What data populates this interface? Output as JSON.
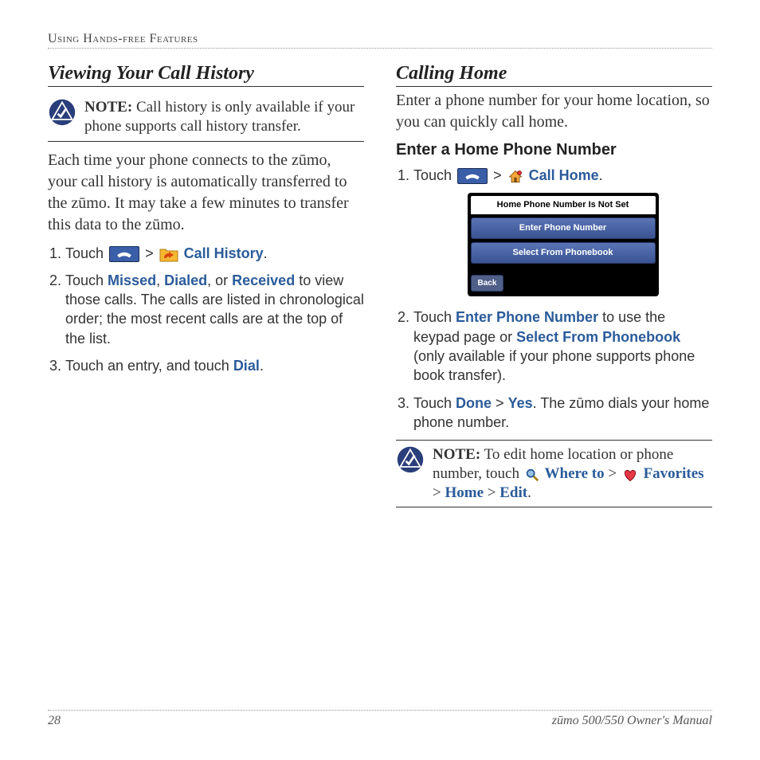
{
  "header": {
    "section": "Using Hands-free Features"
  },
  "left": {
    "heading": "Viewing Your Call History",
    "note": {
      "label": "NOTE:",
      "text": "Call history is only available if your phone supports call history transfer."
    },
    "paragraph": "Each time your phone connects to the zūmo, your call history is automatically transferred to the zūmo. It may take a few minutes to transfer this data to the zūmo.",
    "steps": {
      "s1_pre": "Touch ",
      "s1_sep": " > ",
      "s1_link": "Call History",
      "s1_post": ".",
      "s2_pre": "Touch ",
      "s2_missed": "Missed",
      "s2_c1": ", ",
      "s2_dialed": "Dialed",
      "s2_c2": ", or ",
      "s2_received": "Received",
      "s2_rest": " to view those calls. The calls are listed in chronological order; the most recent calls are at the top of the list.",
      "s3_pre": "Touch an entry, and touch ",
      "s3_dial": "Dial",
      "s3_post": "."
    }
  },
  "right": {
    "heading": "Calling Home",
    "paragraph": "Enter a phone number for your home location, so you can quickly call home.",
    "subheading": "Enter a Home Phone Number",
    "step1_pre": "Touch ",
    "step1_sep": " > ",
    "step1_link": "Call Home",
    "step1_post": ".",
    "device": {
      "title": "Home Phone Number Is Not Set",
      "btn1": "Enter Phone Number",
      "btn2": "Select From Phonebook",
      "back": "Back"
    },
    "step2_pre": "Touch ",
    "step2_link1": "Enter Phone Number",
    "step2_mid": " to use the keypad page or ",
    "step2_link2": "Select From Phonebook",
    "step2_rest": " (only available if your phone supports phone book transfer).",
    "step3_pre": "Touch ",
    "step3_done": "Done",
    "step3_sep": " > ",
    "step3_yes": "Yes",
    "step3_rest": ". The zūmo dials your home phone number.",
    "note2": {
      "label": "NOTE:",
      "pre": "To edit home location or phone number, touch ",
      "where": "Where to",
      "sep1": " > ",
      "fav": "Favorites",
      "sep2": " > ",
      "home": "Home",
      "sep3": " > ",
      "edit": "Edit",
      "post": "."
    }
  },
  "footer": {
    "page": "28",
    "title": "zūmo 500/550 Owner's Manual"
  }
}
